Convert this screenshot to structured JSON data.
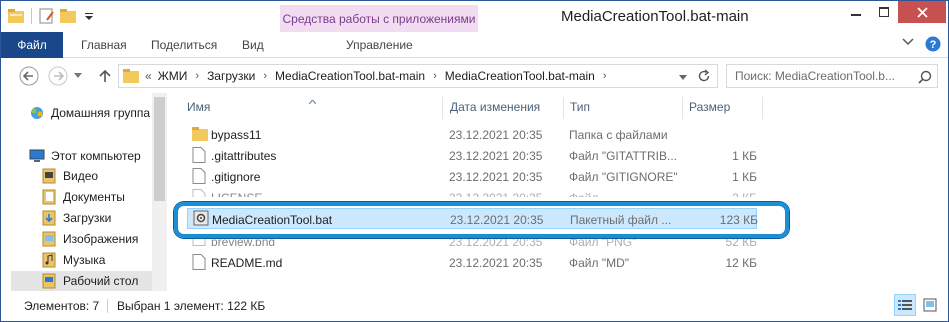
{
  "window": {
    "title": "MediaCreationTool.bat-main",
    "contextual_tab": "Средства работы с приложениями"
  },
  "ribbon": {
    "file": "Файл",
    "tabs": [
      "Главная",
      "Поделиться",
      "Вид",
      "Управление"
    ]
  },
  "address": {
    "prefix": "«",
    "crumbs": [
      "ЖМИ",
      "Загрузки",
      "MediaCreationTool.bat-main",
      "MediaCreationTool.bat-main"
    ]
  },
  "search": {
    "placeholder": "Поиск: MediaCreationTool.b..."
  },
  "nav": {
    "items": [
      {
        "label": "Домашняя группа",
        "icon": "homegroup-icon"
      },
      {
        "label": "Этот компьютер",
        "icon": "computer-icon"
      },
      {
        "label": "Видео",
        "icon": "video-library-icon"
      },
      {
        "label": "Документы",
        "icon": "documents-library-icon"
      },
      {
        "label": "Загрузки",
        "icon": "downloads-folder-icon"
      },
      {
        "label": "Изображения",
        "icon": "pictures-library-icon"
      },
      {
        "label": "Музыка",
        "icon": "music-library-icon"
      },
      {
        "label": "Рабочий стол",
        "icon": "desktop-folder-icon"
      }
    ]
  },
  "columns": {
    "name": "Имя",
    "date": "Дата изменения",
    "type": "Тип",
    "size": "Размер"
  },
  "files": [
    {
      "name": "bypass11",
      "date": "23.12.2021 20:35",
      "type": "Папка с файлами",
      "size": "",
      "icon": "folder-icon"
    },
    {
      "name": ".gitattributes",
      "date": "23.12.2021 20:35",
      "type": "Файл \"GITATTRIB...",
      "size": "1 КБ",
      "icon": "file-icon"
    },
    {
      "name": ".gitignore",
      "date": "23.12.2021 20:35",
      "type": "Файл \"GITIGNORE\"",
      "size": "1 КБ",
      "icon": "file-icon"
    },
    {
      "name": "LICENSE",
      "date": "23.12.2021 20:35",
      "type": "Файл",
      "size": "2 КБ",
      "icon": "file-icon"
    },
    {
      "name": "MediaCreationTool.bat",
      "date": "23.12.2021 20:35",
      "type": "Пакетный файл ...",
      "size": "123 КБ",
      "icon": "batch-file-icon"
    },
    {
      "name": "preview.png",
      "date": "23.12.2021 20:35",
      "type": "Файл \"PNG\"",
      "size": "52 КБ",
      "icon": "image-file-icon"
    },
    {
      "name": "README.md",
      "date": "23.12.2021 20:35",
      "type": "Файл \"MD\"",
      "size": "12 КБ",
      "icon": "file-icon"
    }
  ],
  "status": {
    "items_count": "Элементов: 7",
    "selection": "Выбран 1 элемент: 122 КБ"
  },
  "colors": {
    "accent": "#19478a",
    "context_tab_bg": "#f2dcf2",
    "context_tab_fg": "#7b3c8c",
    "selection_bg": "#cce8ff",
    "highlight_ring": "#1a8fd6",
    "close_button": "#c75050"
  }
}
